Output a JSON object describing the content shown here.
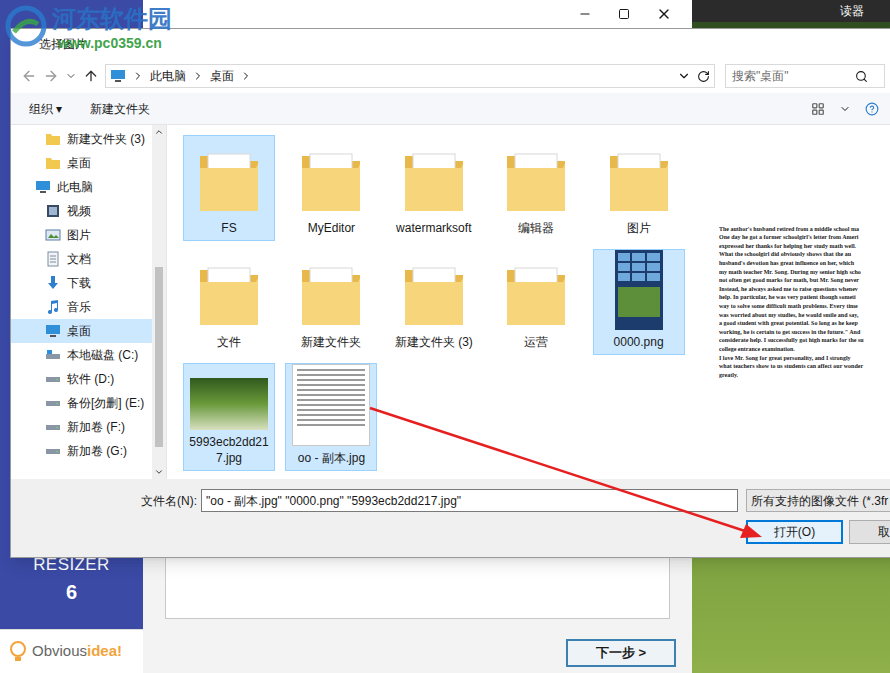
{
  "watermark": {
    "name": "河东软件园",
    "url": "www.pc0359.cn"
  },
  "app": {
    "photo_caption": "读器",
    "sidebar_title": "RESIZER",
    "sidebar_version": "6",
    "logo": [
      "Obvious",
      "idea!"
    ],
    "next_button": "下一步 >"
  },
  "dialog": {
    "title": "选择图片",
    "breadcrumb": [
      "此电脑",
      "桌面"
    ],
    "search_placeholder": "搜索\"桌面\"",
    "toolbar": [
      {
        "label": "组织 ▾"
      },
      {
        "label": "新建文件夹"
      }
    ],
    "nav": [
      {
        "label": "新建文件夹 (3)",
        "icon": "folder",
        "level": 1,
        "selected": false
      },
      {
        "label": "桌面",
        "icon": "folder",
        "level": 1,
        "selected": false
      },
      {
        "label": "此电脑",
        "icon": "pc",
        "level": 0,
        "selected": false
      },
      {
        "label": "视频",
        "icon": "video",
        "level": 1,
        "selected": false
      },
      {
        "label": "图片",
        "icon": "picture",
        "level": 1,
        "selected": false
      },
      {
        "label": "文档",
        "icon": "document",
        "level": 1,
        "selected": false
      },
      {
        "label": "下载",
        "icon": "download",
        "level": 1,
        "selected": false
      },
      {
        "label": "音乐",
        "icon": "music",
        "level": 1,
        "selected": false
      },
      {
        "label": "桌面",
        "icon": "desktop",
        "level": 1,
        "selected": true
      },
      {
        "label": "本地磁盘 (C:)",
        "icon": "system-drive",
        "level": 1,
        "selected": false
      },
      {
        "label": "软件 (D:)",
        "icon": "drive",
        "level": 1,
        "selected": false
      },
      {
        "label": "备份[勿删] (E:)",
        "icon": "drive",
        "level": 1,
        "selected": false
      },
      {
        "label": "新加卷 (F:)",
        "icon": "drive",
        "level": 1,
        "selected": false
      },
      {
        "label": "新加卷 (G:)",
        "icon": "drive",
        "level": 1,
        "selected": false
      }
    ],
    "files": [
      {
        "name": "FS",
        "kind": "folder",
        "selected": true
      },
      {
        "name": "MyEditor",
        "kind": "folder",
        "selected": false
      },
      {
        "name": "watermarksoft",
        "kind": "folder",
        "selected": false
      },
      {
        "name": "编辑器",
        "kind": "folder",
        "selected": false
      },
      {
        "name": "图片",
        "kind": "folder",
        "selected": false
      },
      {
        "name": "文件",
        "kind": "folder",
        "selected": false
      },
      {
        "name": "新建文件夹",
        "kind": "folder",
        "selected": false
      },
      {
        "name": "新建文件夹 (3)",
        "kind": "folder",
        "selected": false
      },
      {
        "name": "运营",
        "kind": "folder",
        "selected": false
      },
      {
        "name": "0000.png",
        "kind": "screenshot",
        "selected": true
      },
      {
        "name": "5993ecb2dd217.jpg",
        "kind": "photo",
        "selected": true
      },
      {
        "name": "oo - 副本.jpg",
        "kind": "document",
        "selected": true
      }
    ],
    "preview_lines": [
      "The author's husband retired from a middle school ma",
      "One day he got a former schoolgirl's letter from Ameri",
      "expressed her thanks for helping her study math well.",
      "What the schoolgirl did obviously shows that the au",
      "husband's devotion has great influence on her, which",
      "my math teacher Mr. Song. During my senior high scho",
      "not often get good marks for math, but Mr. Song never",
      "Instead, he always asked me to raise questions whenev",
      "help. In particular, he was very patient though someti",
      "way to solve some difficult math problems. Every time",
      "was worried about my studies, he would smile and say,",
      "a good student with great potential. So long as he keep",
      "working, he is certain to get success in the future.\" And",
      "considerate help. I successfully got high marks for the su",
      "college entrance examination.",
      "I love Mr. Song for great personality, and I strongly",
      "what teachers show to us students can affect our wonder",
      "greatly."
    ],
    "filename_label": "文件名(N):",
    "filename_value": "\"oo - 副本.jpg\" \"0000.png\" \"5993ecb2dd217.jpg\"",
    "filter": "所有支持的图像文件 (*.3fr",
    "buttons": [
      {
        "label": "打开(O)",
        "highlighted": true
      },
      {
        "label": "取",
        "highlighted": false
      }
    ]
  }
}
